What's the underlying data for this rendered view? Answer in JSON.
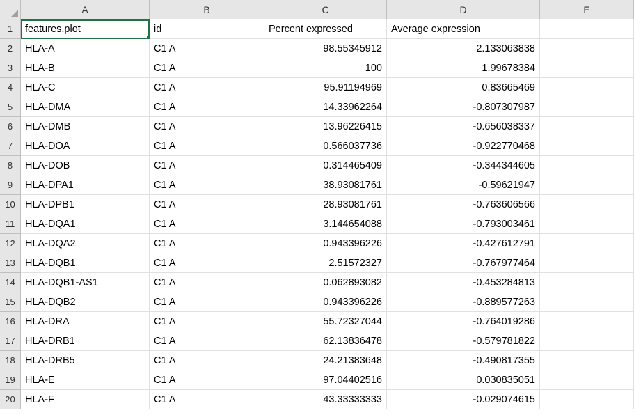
{
  "columns": [
    "A",
    "B",
    "C",
    "D",
    "E"
  ],
  "activeCell": {
    "row": 1,
    "col": "A"
  },
  "headers": {
    "A": "features.plot",
    "B": "id",
    "C": "Percent expressed",
    "D": "Average expression",
    "E": ""
  },
  "rows": [
    {
      "n": 2,
      "A": "HLA-A",
      "B": "C1 A",
      "C": "98.55345912",
      "D": "2.133063838"
    },
    {
      "n": 3,
      "A": "HLA-B",
      "B": "C1 A",
      "C": "100",
      "D": "1.99678384"
    },
    {
      "n": 4,
      "A": "HLA-C",
      "B": "C1 A",
      "C": "95.91194969",
      "D": "0.83665469"
    },
    {
      "n": 5,
      "A": "HLA-DMA",
      "B": "C1 A",
      "C": "14.33962264",
      "D": "-0.807307987"
    },
    {
      "n": 6,
      "A": "HLA-DMB",
      "B": "C1 A",
      "C": "13.96226415",
      "D": "-0.656038337"
    },
    {
      "n": 7,
      "A": "HLA-DOA",
      "B": "C1 A",
      "C": "0.566037736",
      "D": "-0.922770468"
    },
    {
      "n": 8,
      "A": "HLA-DOB",
      "B": "C1 A",
      "C": "0.314465409",
      "D": "-0.344344605"
    },
    {
      "n": 9,
      "A": "HLA-DPA1",
      "B": "C1 A",
      "C": "38.93081761",
      "D": "-0.59621947"
    },
    {
      "n": 10,
      "A": "HLA-DPB1",
      "B": "C1 A",
      "C": "28.93081761",
      "D": "-0.763606566"
    },
    {
      "n": 11,
      "A": "HLA-DQA1",
      "B": "C1 A",
      "C": "3.144654088",
      "D": "-0.793003461"
    },
    {
      "n": 12,
      "A": "HLA-DQA2",
      "B": "C1 A",
      "C": "0.943396226",
      "D": "-0.427612791"
    },
    {
      "n": 13,
      "A": "HLA-DQB1",
      "B": "C1 A",
      "C": "2.51572327",
      "D": "-0.767977464"
    },
    {
      "n": 14,
      "A": "HLA-DQB1-AS1",
      "B": "C1 A",
      "C": "0.062893082",
      "D": "-0.453284813"
    },
    {
      "n": 15,
      "A": "HLA-DQB2",
      "B": "C1 A",
      "C": "0.943396226",
      "D": "-0.889577263"
    },
    {
      "n": 16,
      "A": "HLA-DRA",
      "B": "C1 A",
      "C": "55.72327044",
      "D": "-0.764019286"
    },
    {
      "n": 17,
      "A": "HLA-DRB1",
      "B": "C1 A",
      "C": "62.13836478",
      "D": "-0.579781822"
    },
    {
      "n": 18,
      "A": "HLA-DRB5",
      "B": "C1 A",
      "C": "24.21383648",
      "D": "-0.490817355"
    },
    {
      "n": 19,
      "A": "HLA-E",
      "B": "C1 A",
      "C": "97.04402516",
      "D": "0.030835051"
    },
    {
      "n": 20,
      "A": "HLA-F",
      "B": "C1 A",
      "C": "43.33333333",
      "D": "-0.029074615"
    }
  ]
}
